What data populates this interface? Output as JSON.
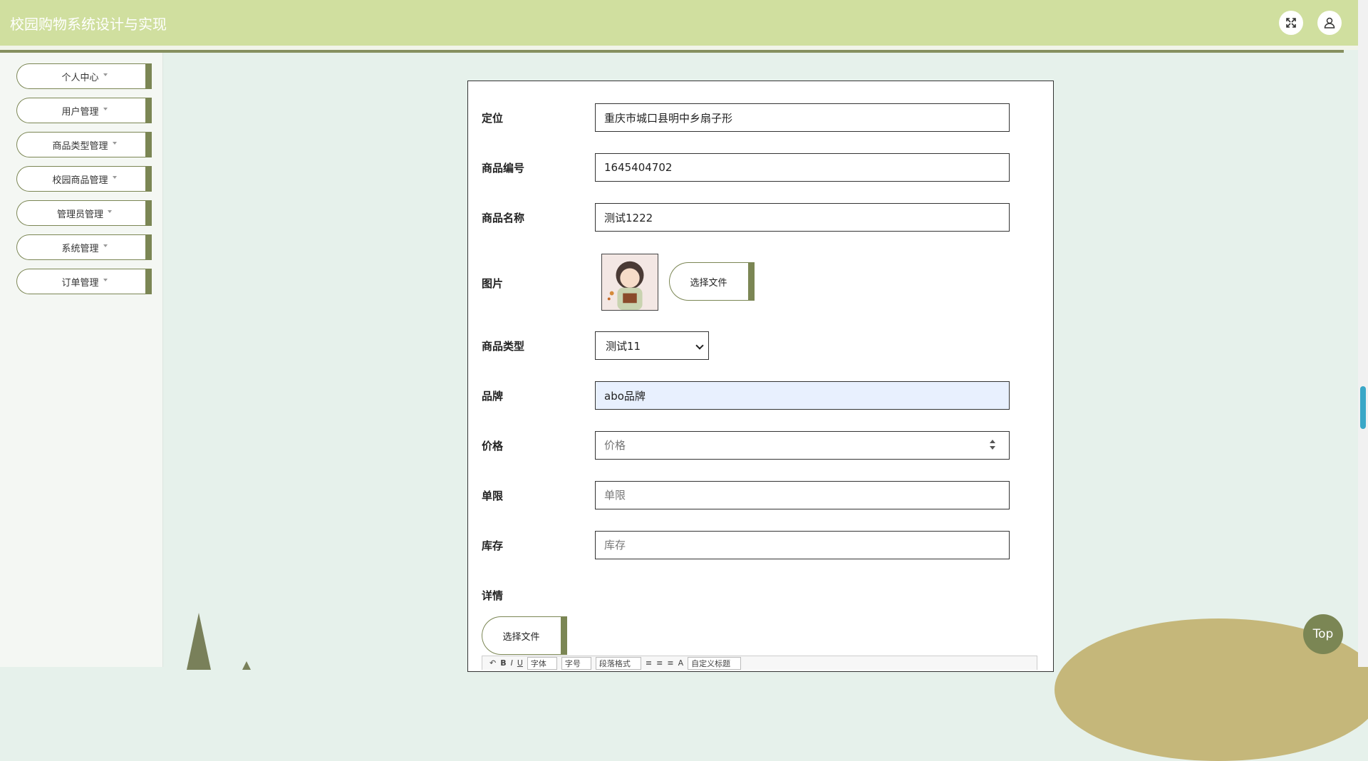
{
  "header": {
    "title": "校园购物系统设计与实现"
  },
  "sidebar": {
    "items": [
      {
        "label": "个人中心"
      },
      {
        "label": "用户管理"
      },
      {
        "label": "商品类型管理"
      },
      {
        "label": "校园商品管理"
      },
      {
        "label": "管理员管理"
      },
      {
        "label": "系统管理"
      },
      {
        "label": "订单管理"
      }
    ]
  },
  "form": {
    "location": {
      "label": "定位",
      "value": "重庆市城口县明中乡扇子形"
    },
    "code": {
      "label": "商品编号",
      "value": "1645404702"
    },
    "name": {
      "label": "商品名称",
      "value": "测试1222"
    },
    "image": {
      "label": "图片",
      "button": "选择文件"
    },
    "type": {
      "label": "商品类型",
      "selected": "测试11"
    },
    "brand": {
      "label": "品牌",
      "value": "abo品牌"
    },
    "price": {
      "label": "价格",
      "placeholder": "价格"
    },
    "limit": {
      "label": "单限",
      "placeholder": "单限"
    },
    "stock": {
      "label": "库存",
      "placeholder": "库存"
    },
    "detail": {
      "label": "详情",
      "button": "选择文件"
    },
    "editor_toolbar": {
      "font_family": "字体",
      "font_size": "字号",
      "paragraph": "段落格式",
      "custom_title": "自定义标题"
    }
  },
  "top_button": "Top",
  "colors": {
    "header": "#d0df9f",
    "accent": "#7b8654",
    "background": "#e6f1eb"
  }
}
